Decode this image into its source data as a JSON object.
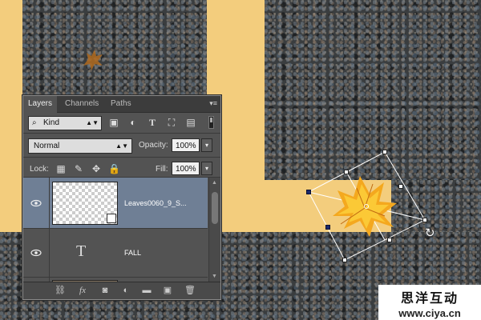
{
  "panel": {
    "tabs": [
      {
        "label": "Layers",
        "active": true
      },
      {
        "label": "Channels",
        "active": false
      },
      {
        "label": "Paths",
        "active": false
      }
    ],
    "filter": {
      "kind_label": "Kind",
      "icons": [
        "pixel-filter-icon",
        "adjustment-filter-icon",
        "type-filter-icon",
        "shape-filter-icon",
        "smart-object-filter-icon"
      ]
    },
    "blend_mode": "Normal",
    "opacity_label": "Opacity:",
    "opacity_value": "100%",
    "lock_label": "Lock:",
    "lock_icons": [
      "lock-transparent-icon",
      "lock-image-icon",
      "lock-position-icon",
      "lock-all-icon"
    ],
    "fill_label": "Fill:",
    "fill_value": "100%",
    "layers": [
      {
        "name": "Leaves0060_9_S...",
        "type": "smart-object",
        "visible": true,
        "selected": true
      },
      {
        "name": "FALL",
        "type": "text",
        "type_glyph": "T",
        "visible": true,
        "selected": false
      },
      {
        "name": "",
        "type": "image",
        "visible": true,
        "selected": false
      }
    ],
    "bottom_icons": [
      {
        "name": "link-layers-icon",
        "glyph": "⛓"
      },
      {
        "name": "layer-style-icon",
        "glyph": "fx"
      },
      {
        "name": "add-mask-icon",
        "glyph": "◙"
      },
      {
        "name": "adjustment-layer-icon",
        "glyph": "◐"
      },
      {
        "name": "new-group-icon",
        "glyph": "▬"
      },
      {
        "name": "new-layer-icon",
        "glyph": "▣"
      },
      {
        "name": "delete-layer-icon",
        "glyph": "🗑"
      }
    ]
  },
  "canvas": {
    "background_color": "#f3cd7d",
    "asphalt_color": "#3a3d3f"
  },
  "watermark": {
    "title": "思洋互动",
    "url": "www.ciya.cn"
  }
}
